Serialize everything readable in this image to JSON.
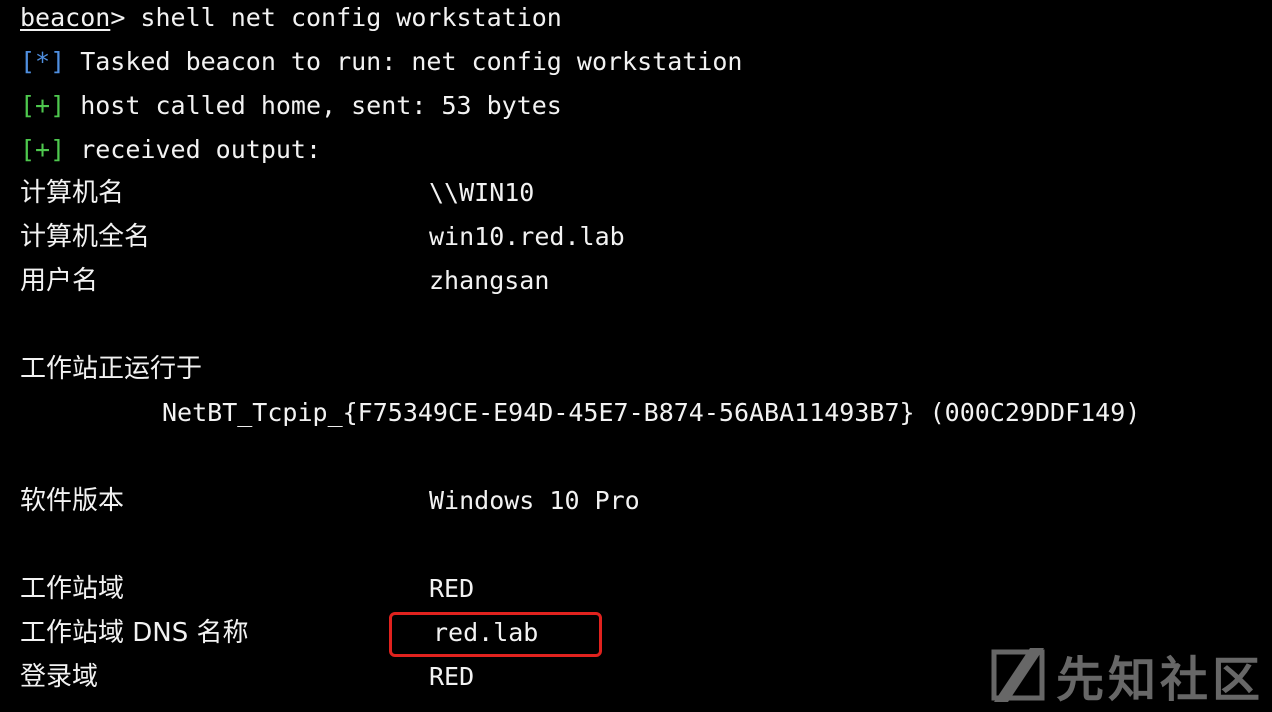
{
  "prompt": {
    "user": "beacon",
    "symbol": ">",
    "command": " shell net config workstation"
  },
  "status_lines": [
    {
      "tag": "[*]",
      "text": " Tasked beacon to run: net config workstation"
    },
    {
      "tag": "[+]",
      "text": " host called home, sent: 53 bytes"
    },
    {
      "tag": "[+]",
      "text": " received output:"
    }
  ],
  "output": {
    "computer_name_key": "计算机名",
    "computer_name_val": "\\\\WIN10",
    "full_name_key": "计算机全名",
    "full_name_val": "win10.red.lab",
    "user_name_key": "用户名",
    "user_name_val": "zhangsan",
    "running_on_key": "工作站正运行于",
    "running_on_val": "NetBT_Tcpip_{F75349CE-E94D-45E7-B874-56ABA11493B7} (000C29DDF149)",
    "software_version_key": "软件版本",
    "software_version_val": "Windows 10 Pro",
    "workstation_domain_key": "工作站域",
    "workstation_domain_val": "RED",
    "dns_name_key": "工作站域 DNS 名称",
    "dns_name_val": "red.lab",
    "logon_domain_key": "登录域",
    "logon_domain_val": "RED"
  },
  "watermark": {
    "text": "先知社区",
    "icon": "xianzhi-logo-icon"
  },
  "colors": {
    "background": "#000000",
    "text": "#f2f2f2",
    "info_tag": "#4f8fe0",
    "success_tag": "#4ec84e",
    "highlight": "#e0221e"
  }
}
